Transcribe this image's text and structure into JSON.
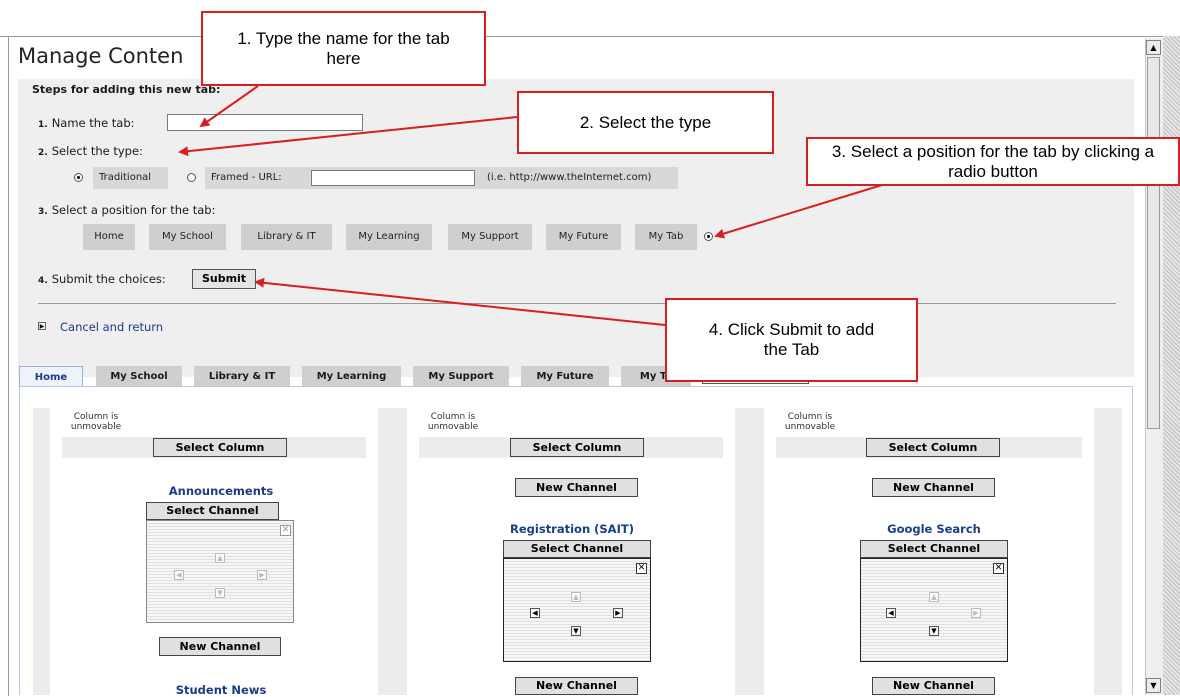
{
  "page": {
    "title": "Manage Conten"
  },
  "steps": {
    "heading": "Steps for adding this new tab:",
    "s1": {
      "num": "1.",
      "label": "Name the tab:",
      "value": ""
    },
    "s2": {
      "num": "2.",
      "label": "Select the type:"
    },
    "type_options": {
      "traditional": "Traditional",
      "framed": "Framed  -  URL:",
      "url_value": "",
      "hint": "(i.e. http://www.theInternet.com)"
    },
    "s3": {
      "num": "3.",
      "label": "Select a position for the tab:"
    },
    "positions": [
      "Home",
      "My School",
      "Library & IT",
      "My Learning",
      "My Support",
      "My Future",
      "My Tab"
    ],
    "s4": {
      "num": "4.",
      "label": "Submit the choices:",
      "button": "Submit"
    }
  },
  "cancel": {
    "label": "Cancel and return"
  },
  "tabs": [
    "Home",
    "My School",
    "Library & IT",
    "My Learning",
    "My Support",
    "My Future",
    "My Ta"
  ],
  "columns": {
    "unmovable": "Column is unmovable",
    "select_column": "Select Column",
    "new_channel": "New Channel",
    "select_channel": "Select Channel",
    "col1": {
      "channel": "Announcements",
      "channel2": "Student News"
    },
    "col2": {
      "channel": "Registration (SAIT)"
    },
    "col3": {
      "channel": "Google Search"
    }
  },
  "callouts": {
    "c1": "1. Type the name for the tab here",
    "c2": "2. Select the type",
    "c3": "3. Select a position for the tab by clicking a radio button",
    "c4": "4. Click Submit to add the Tab"
  },
  "colors": {
    "annotation_red": "#d81e1e",
    "link_blue": "#1a3c8a",
    "panel_gray": "#efefef"
  }
}
